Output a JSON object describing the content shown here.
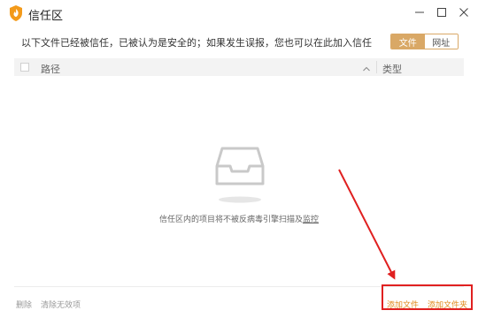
{
  "window": {
    "title": "信任区",
    "icon": "shield-icon",
    "controls": [
      "minimize-icon",
      "maximize-icon",
      "close-icon"
    ]
  },
  "notice": {
    "text": "以下文件已经被信任，已被认为是安全的；如果发生误报，您也可以在此加入信任"
  },
  "tabs": {
    "file_label": "文件",
    "url_label": "网址",
    "active": "file"
  },
  "table": {
    "col_path": "路径",
    "col_type": "类型",
    "rows": []
  },
  "empty_state": {
    "text_before": "信任区内的项目将不被反病毒引擎扫描及",
    "link_text": "监控",
    "icon": "empty-tray-icon"
  },
  "footer": {
    "delete_label": "删除",
    "clear_invalid_label": "清除无效项",
    "add_file_label": "添加文件",
    "add_folder_label": "添加文件夹"
  },
  "colors": {
    "accent": "#d9a866",
    "link": "#e08a1c",
    "annotation": "#e02020"
  }
}
